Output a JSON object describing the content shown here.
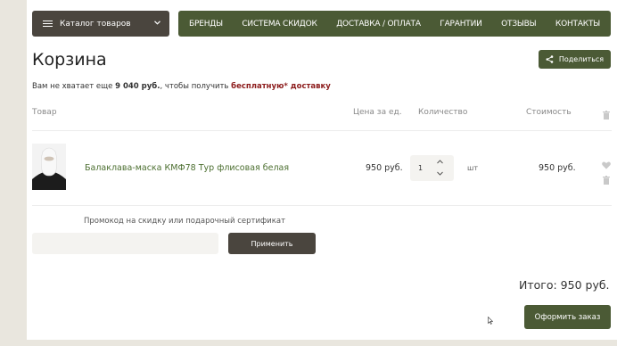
{
  "header": {
    "catalog_label": "Каталог товаров",
    "nav": [
      "БРЕНДЫ",
      "СИСТЕМА СКИДОК",
      "ДОСТАВКА / ОПЛАТА",
      "ГАРАНТИИ",
      "ОТЗЫВЫ",
      "КОНТАКТЫ"
    ]
  },
  "cart": {
    "title": "Корзина",
    "share_label": "Поделиться",
    "notice": {
      "prefix": "Вам не хватает еще ",
      "amount": "9 040 руб.",
      "middle": ", чтобы получить ",
      "free_delivery": "бесплатную* доставку"
    },
    "columns": {
      "product": "Товар",
      "unit_price": "Цена за ед.",
      "quantity": "Количество",
      "cost": "Стоимость"
    },
    "items": [
      {
        "name": "Балаклава-маска КМФ78 Тур флисовая белая",
        "price": "950 руб.",
        "quantity": "1",
        "unit": "шт",
        "cost": "950 руб."
      }
    ],
    "promo_label": "Промокод на скидку или подарочный сертификат",
    "promo_value": "",
    "apply_label": "Применить",
    "total": "Итого: 950 руб.",
    "order_label": "Оформить заказ"
  },
  "icons": {
    "menu": "burger-menu-icon",
    "chevron": "chevron-down-icon",
    "share": "share-icon",
    "trash": "trash-icon",
    "heart": "heart-icon",
    "up": "chevron-up-icon",
    "down": "chevron-down-icon"
  },
  "colors": {
    "nav_green": "#4b5a35",
    "dark_brown": "#4a453e",
    "link_green": "#4b6e2f",
    "accent_red": "#8c1b1b"
  }
}
